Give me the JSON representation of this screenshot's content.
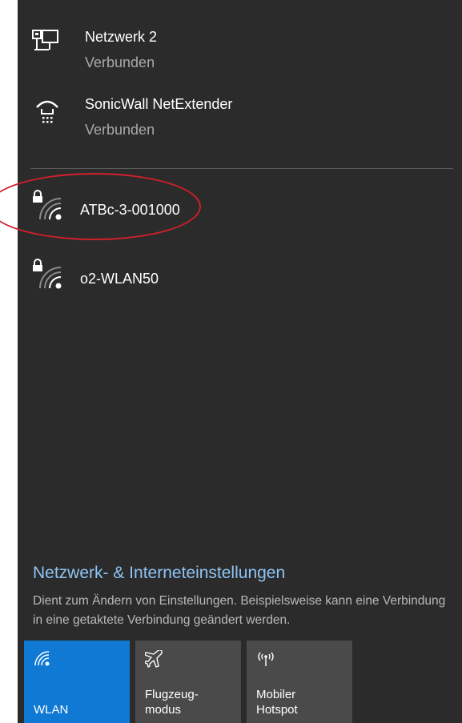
{
  "connections": [
    {
      "name": "Netzwerk 2",
      "status": "Verbunden",
      "icon": "ethernet-icon"
    },
    {
      "name": "SonicWall NetExtender",
      "status": "Verbunden",
      "icon": "vpn-dialup-icon"
    }
  ],
  "wifi_networks": [
    {
      "name": "ATBc-3-001000",
      "secured": true,
      "icon": "wifi-secured-icon",
      "highlighted": true
    },
    {
      "name": "o2-WLAN50",
      "secured": true,
      "icon": "wifi-secured-icon",
      "highlighted": false
    }
  ],
  "settings": {
    "link": "Netzwerk- & Interneteinstellungen",
    "description": "Dient zum Ändern von Einstellungen. Beispielsweise kann eine Verbindung in eine getaktete Verbindung geändert werden."
  },
  "quick_actions": [
    {
      "label": "WLAN",
      "icon": "wifi-icon",
      "active": true
    },
    {
      "label": "Flugzeug-\nmodus",
      "icon": "airplane-icon",
      "active": false
    },
    {
      "label": "Mobiler\nHotspot",
      "icon": "hotspot-icon",
      "active": false
    }
  ],
  "colors": {
    "background": "#2b2b2b",
    "accent": "#0f79d3",
    "link": "#8ec4f5",
    "annotation": "#d0202a"
  }
}
